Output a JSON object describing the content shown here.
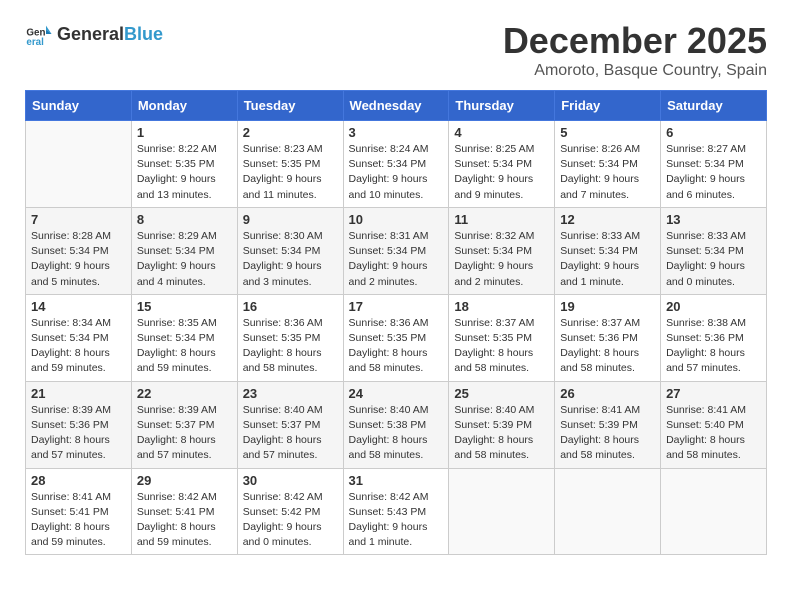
{
  "header": {
    "logo_general": "General",
    "logo_blue": "Blue",
    "month_title": "December 2025",
    "location": "Amoroto, Basque Country, Spain"
  },
  "weekdays": [
    "Sunday",
    "Monday",
    "Tuesday",
    "Wednesday",
    "Thursday",
    "Friday",
    "Saturday"
  ],
  "weeks": [
    [
      {
        "day": "",
        "info": ""
      },
      {
        "day": "1",
        "info": "Sunrise: 8:22 AM\nSunset: 5:35 PM\nDaylight: 9 hours\nand 13 minutes."
      },
      {
        "day": "2",
        "info": "Sunrise: 8:23 AM\nSunset: 5:35 PM\nDaylight: 9 hours\nand 11 minutes."
      },
      {
        "day": "3",
        "info": "Sunrise: 8:24 AM\nSunset: 5:34 PM\nDaylight: 9 hours\nand 10 minutes."
      },
      {
        "day": "4",
        "info": "Sunrise: 8:25 AM\nSunset: 5:34 PM\nDaylight: 9 hours\nand 9 minutes."
      },
      {
        "day": "5",
        "info": "Sunrise: 8:26 AM\nSunset: 5:34 PM\nDaylight: 9 hours\nand 7 minutes."
      },
      {
        "day": "6",
        "info": "Sunrise: 8:27 AM\nSunset: 5:34 PM\nDaylight: 9 hours\nand 6 minutes."
      }
    ],
    [
      {
        "day": "7",
        "info": "Sunrise: 8:28 AM\nSunset: 5:34 PM\nDaylight: 9 hours\nand 5 minutes."
      },
      {
        "day": "8",
        "info": "Sunrise: 8:29 AM\nSunset: 5:34 PM\nDaylight: 9 hours\nand 4 minutes."
      },
      {
        "day": "9",
        "info": "Sunrise: 8:30 AM\nSunset: 5:34 PM\nDaylight: 9 hours\nand 3 minutes."
      },
      {
        "day": "10",
        "info": "Sunrise: 8:31 AM\nSunset: 5:34 PM\nDaylight: 9 hours\nand 2 minutes."
      },
      {
        "day": "11",
        "info": "Sunrise: 8:32 AM\nSunset: 5:34 PM\nDaylight: 9 hours\nand 2 minutes."
      },
      {
        "day": "12",
        "info": "Sunrise: 8:33 AM\nSunset: 5:34 PM\nDaylight: 9 hours\nand 1 minute."
      },
      {
        "day": "13",
        "info": "Sunrise: 8:33 AM\nSunset: 5:34 PM\nDaylight: 9 hours\nand 0 minutes."
      }
    ],
    [
      {
        "day": "14",
        "info": "Sunrise: 8:34 AM\nSunset: 5:34 PM\nDaylight: 8 hours\nand 59 minutes."
      },
      {
        "day": "15",
        "info": "Sunrise: 8:35 AM\nSunset: 5:34 PM\nDaylight: 8 hours\nand 59 minutes."
      },
      {
        "day": "16",
        "info": "Sunrise: 8:36 AM\nSunset: 5:35 PM\nDaylight: 8 hours\nand 58 minutes."
      },
      {
        "day": "17",
        "info": "Sunrise: 8:36 AM\nSunset: 5:35 PM\nDaylight: 8 hours\nand 58 minutes."
      },
      {
        "day": "18",
        "info": "Sunrise: 8:37 AM\nSunset: 5:35 PM\nDaylight: 8 hours\nand 58 minutes."
      },
      {
        "day": "19",
        "info": "Sunrise: 8:37 AM\nSunset: 5:36 PM\nDaylight: 8 hours\nand 58 minutes."
      },
      {
        "day": "20",
        "info": "Sunrise: 8:38 AM\nSunset: 5:36 PM\nDaylight: 8 hours\nand 57 minutes."
      }
    ],
    [
      {
        "day": "21",
        "info": "Sunrise: 8:39 AM\nSunset: 5:36 PM\nDaylight: 8 hours\nand 57 minutes."
      },
      {
        "day": "22",
        "info": "Sunrise: 8:39 AM\nSunset: 5:37 PM\nDaylight: 8 hours\nand 57 minutes."
      },
      {
        "day": "23",
        "info": "Sunrise: 8:40 AM\nSunset: 5:37 PM\nDaylight: 8 hours\nand 57 minutes."
      },
      {
        "day": "24",
        "info": "Sunrise: 8:40 AM\nSunset: 5:38 PM\nDaylight: 8 hours\nand 58 minutes."
      },
      {
        "day": "25",
        "info": "Sunrise: 8:40 AM\nSunset: 5:39 PM\nDaylight: 8 hours\nand 58 minutes."
      },
      {
        "day": "26",
        "info": "Sunrise: 8:41 AM\nSunset: 5:39 PM\nDaylight: 8 hours\nand 58 minutes."
      },
      {
        "day": "27",
        "info": "Sunrise: 8:41 AM\nSunset: 5:40 PM\nDaylight: 8 hours\nand 58 minutes."
      }
    ],
    [
      {
        "day": "28",
        "info": "Sunrise: 8:41 AM\nSunset: 5:41 PM\nDaylight: 8 hours\nand 59 minutes."
      },
      {
        "day": "29",
        "info": "Sunrise: 8:42 AM\nSunset: 5:41 PM\nDaylight: 8 hours\nand 59 minutes."
      },
      {
        "day": "30",
        "info": "Sunrise: 8:42 AM\nSunset: 5:42 PM\nDaylight: 9 hours\nand 0 minutes."
      },
      {
        "day": "31",
        "info": "Sunrise: 8:42 AM\nSunset: 5:43 PM\nDaylight: 9 hours\nand 1 minute."
      },
      {
        "day": "",
        "info": ""
      },
      {
        "day": "",
        "info": ""
      },
      {
        "day": "",
        "info": ""
      }
    ]
  ]
}
